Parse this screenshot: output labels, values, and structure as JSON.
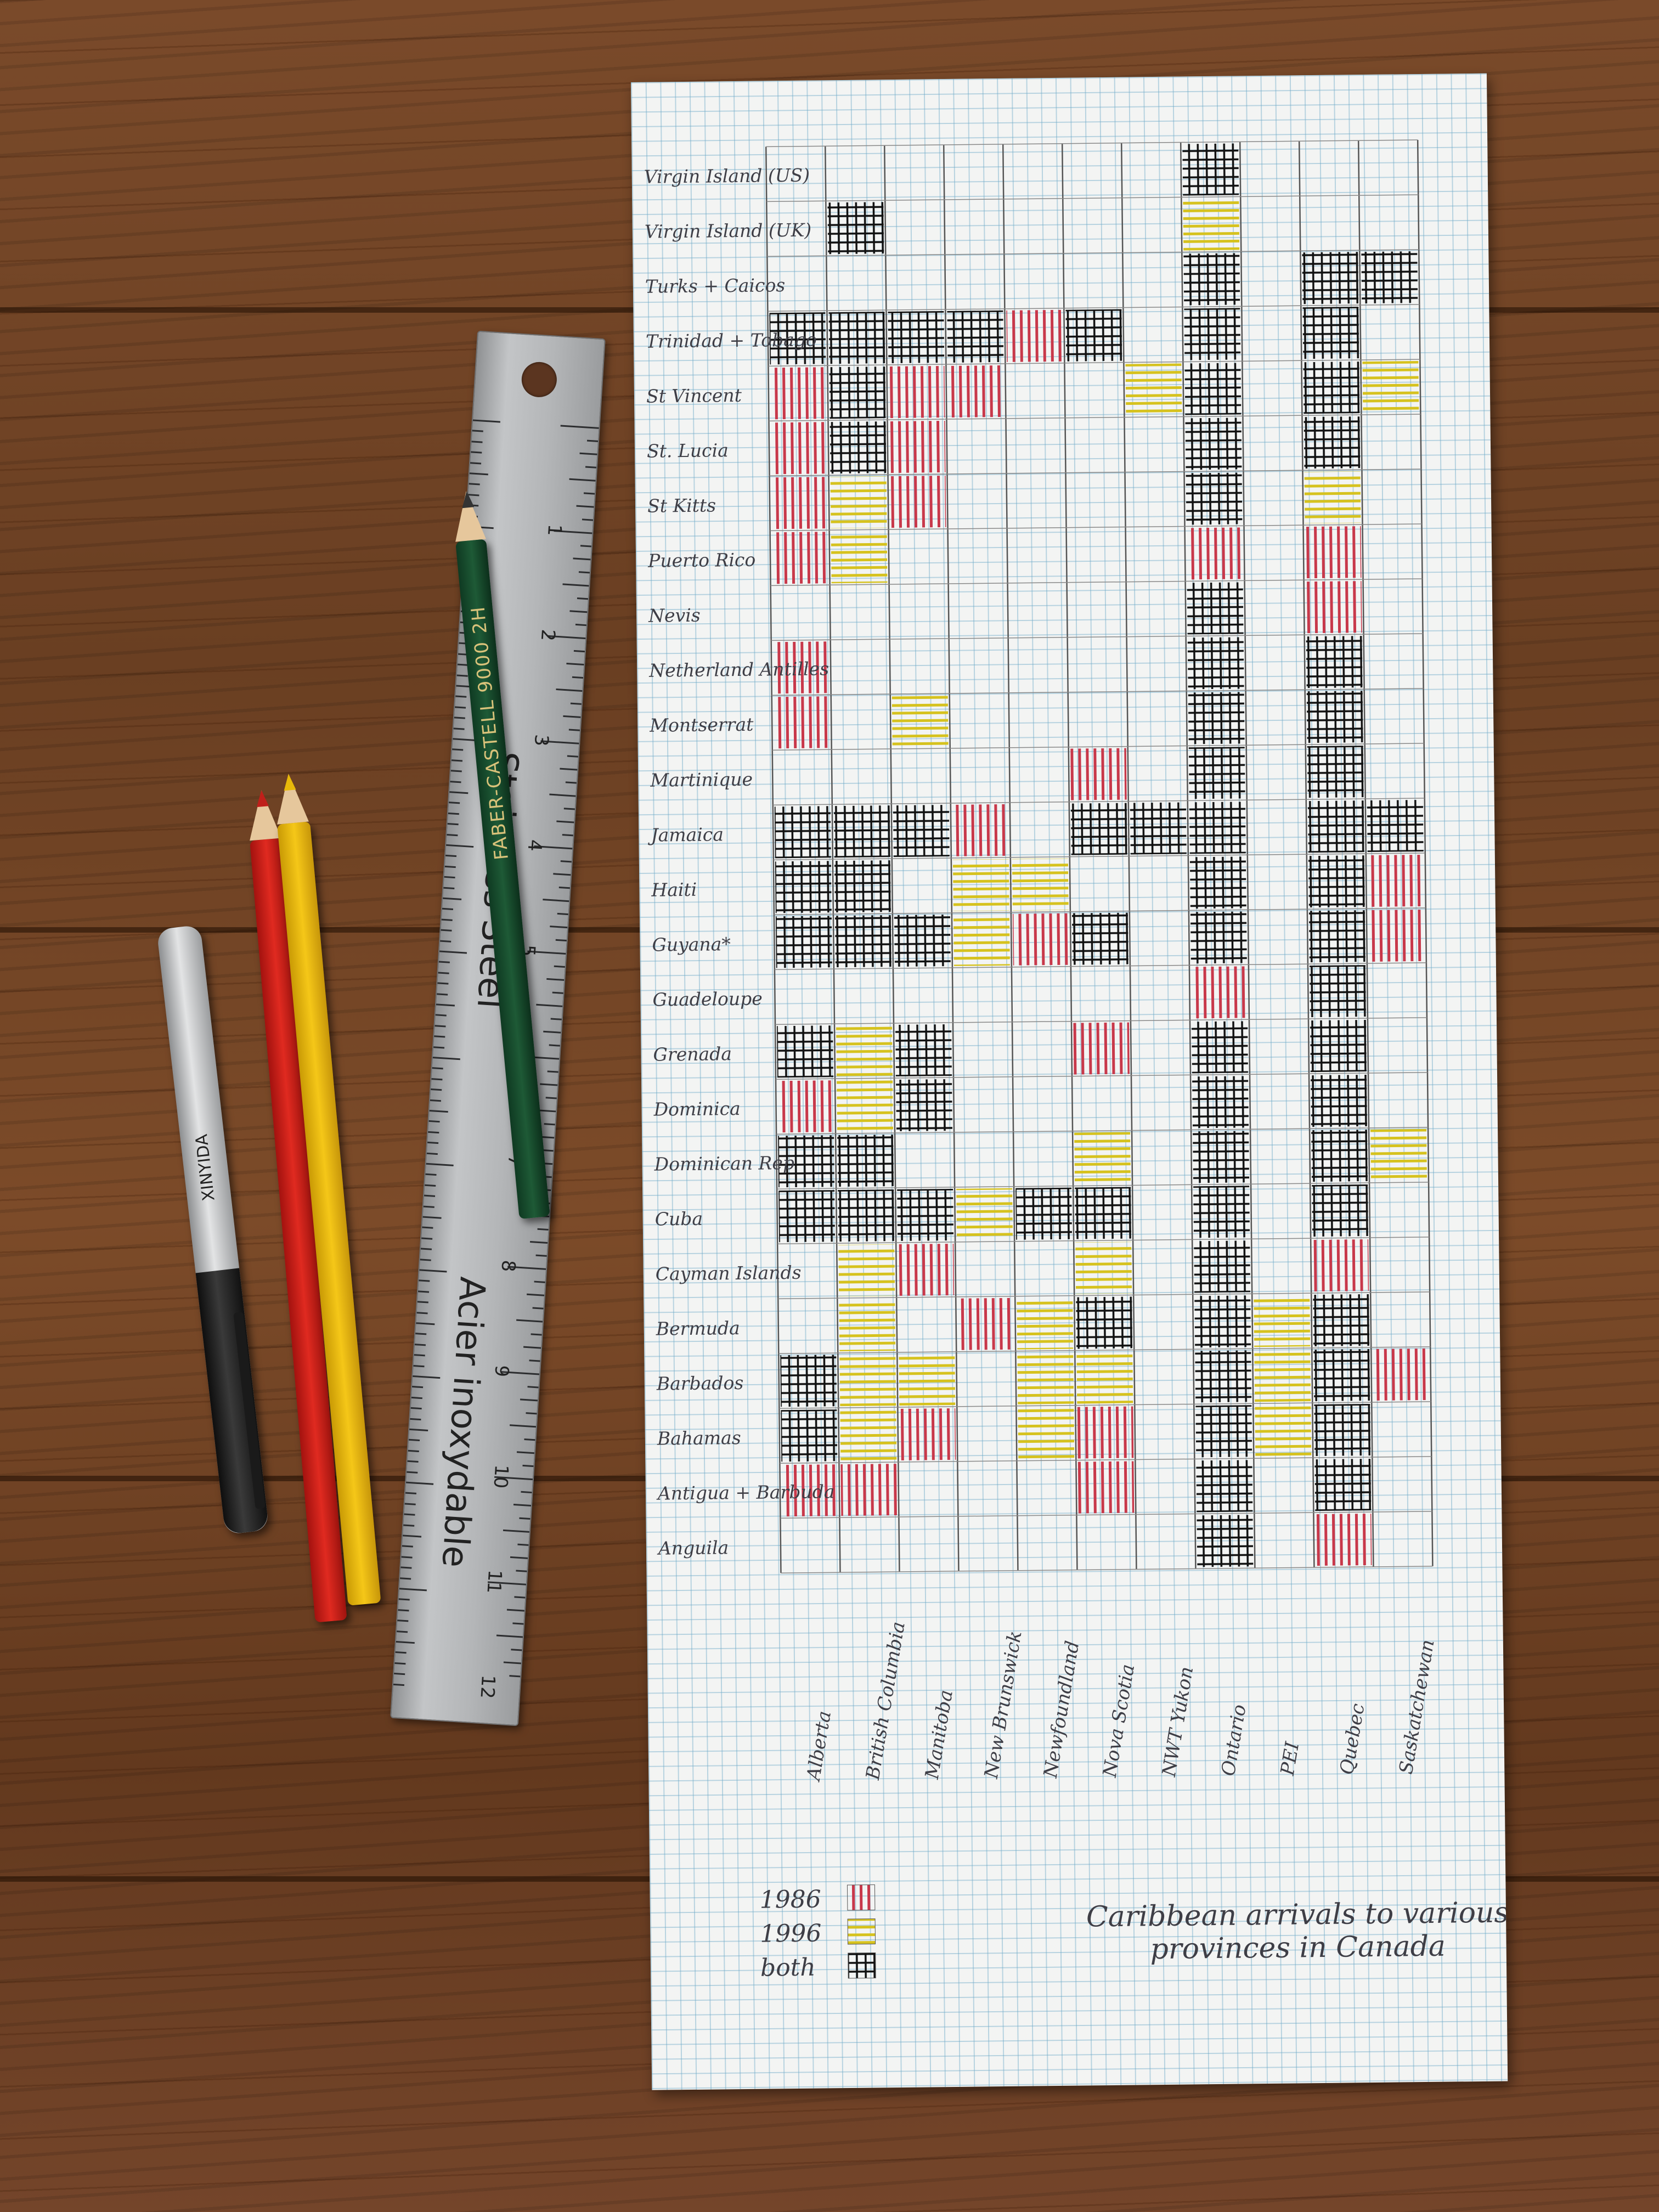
{
  "chart_data": {
    "type": "heatmap",
    "title": "Caribbean arrivals to various provinces in Canada",
    "rows": [
      "Virgin Island (US)",
      "Virgin Island (UK)",
      "Turks + Caicos",
      "Trinidad + Tobago",
      "St Vincent",
      "St. Lucia",
      "St Kitts",
      "Puerto Rico",
      "Nevis",
      "Netherland Antilles",
      "Montserrat",
      "Martinique",
      "Jamaica",
      "Haiti",
      "Guyana*",
      "Guadeloupe",
      "Grenada",
      "Dominica",
      "Dominican Rep",
      "Cuba",
      "Cayman Islands",
      "Bermuda",
      "Barbados",
      "Bahamas",
      "Antigua + Barbuda",
      "Anguila"
    ],
    "columns": [
      "Alberta",
      "British Columbia",
      "Manitoba",
      "New Brunswick",
      "Newfoundland",
      "Nova Scotia",
      "NWT Yukon",
      "Ontario",
      "PEI",
      "Quebec",
      "Saskatchewan"
    ],
    "legend": [
      {
        "code": "1986",
        "label": "1986",
        "color": "#c8384a"
      },
      {
        "code": "1996",
        "label": "1996",
        "color": "#d6c21e"
      },
      {
        "code": "both",
        "label": "both",
        "color": "#111111"
      }
    ],
    "cells": [
      [
        "",
        "",
        "",
        "",
        "",
        "",
        "",
        "both",
        "",
        "",
        ""
      ],
      [
        "",
        "both",
        "",
        "",
        "",
        "",
        "",
        "1996",
        "",
        "",
        ""
      ],
      [
        "",
        "",
        "",
        "",
        "",
        "",
        "",
        "both",
        "",
        "both",
        "both"
      ],
      [
        "both",
        "both",
        "both",
        "both",
        "1986",
        "both",
        "",
        "both",
        "",
        "both",
        ""
      ],
      [
        "1986",
        "both",
        "1986",
        "1986",
        "",
        "",
        "1996",
        "both",
        "",
        "both",
        "1996"
      ],
      [
        "1986",
        "both",
        "1986",
        "",
        "",
        "",
        "",
        "both",
        "",
        "both",
        ""
      ],
      [
        "1986",
        "1996",
        "1986",
        "",
        "",
        "",
        "",
        "both",
        "",
        "1996",
        ""
      ],
      [
        "1986",
        "1996",
        "",
        "",
        "",
        "",
        "",
        "1986",
        "",
        "1986",
        ""
      ],
      [
        "",
        "",
        "",
        "",
        "",
        "",
        "",
        "both",
        "",
        "1986",
        ""
      ],
      [
        "1986",
        "",
        "",
        "",
        "",
        "",
        "",
        "both",
        "",
        "both",
        ""
      ],
      [
        "1986",
        "",
        "1996",
        "",
        "",
        "",
        "",
        "both",
        "",
        "both",
        ""
      ],
      [
        "",
        "",
        "",
        "",
        "",
        "1986",
        "",
        "both",
        "",
        "both",
        ""
      ],
      [
        "both",
        "both",
        "both",
        "1986",
        "",
        "both",
        "both",
        "both",
        "",
        "both",
        "both"
      ],
      [
        "both",
        "both",
        "",
        "1996",
        "1996",
        "",
        "",
        "both",
        "",
        "both",
        "1986"
      ],
      [
        "both",
        "both",
        "both",
        "1996",
        "1986",
        "both",
        "",
        "both",
        "",
        "both",
        "1986"
      ],
      [
        "",
        "",
        "",
        "",
        "",
        "",
        "",
        "1986",
        "",
        "both",
        ""
      ],
      [
        "both",
        "1996",
        "both",
        "",
        "",
        "1986",
        "",
        "both",
        "",
        "both",
        ""
      ],
      [
        "1986",
        "1996",
        "both",
        "",
        "",
        "",
        "",
        "both",
        "",
        "both",
        ""
      ],
      [
        "both",
        "both",
        "",
        "",
        "",
        "1996",
        "",
        "both",
        "",
        "both",
        "1996"
      ],
      [
        "both",
        "both",
        "both",
        "1996",
        "both",
        "both",
        "",
        "both",
        "",
        "both",
        ""
      ],
      [
        "",
        "1996",
        "1986",
        "",
        "",
        "1996",
        "",
        "both",
        "",
        "1986",
        ""
      ],
      [
        "",
        "1996",
        "",
        "1986",
        "1996",
        "both",
        "",
        "both",
        "1996",
        "both",
        ""
      ],
      [
        "both",
        "1996",
        "1996",
        "",
        "1996",
        "1996",
        "",
        "both",
        "1996",
        "both",
        "1986"
      ],
      [
        "both",
        "1996",
        "1986",
        "",
        "1996",
        "1986",
        "",
        "both",
        "1996",
        "both",
        ""
      ],
      [
        "1986",
        "1986",
        "",
        "",
        "",
        "1986",
        "",
        "both",
        "",
        "both",
        ""
      ],
      [
        "",
        "",
        "",
        "",
        "",
        "",
        "",
        "both",
        "",
        "1986",
        ""
      ]
    ]
  },
  "props": {
    "ruler_text_1": "Stainless Steel",
    "ruler_text_2": "Acier inoxydable",
    "ruler_inch_numbers": [
      "1",
      "2",
      "3",
      "4",
      "5",
      "6",
      "7",
      "8",
      "9",
      "10",
      "11",
      "12"
    ],
    "pencil_brand": "FABER-CASTELL 9000 2H",
    "pen_brand": "XINYIDA"
  },
  "colors": {
    "wood": "#6f4426",
    "paper": "#f3f4f3",
    "grid_line": "#6eaac8",
    "ink": "#111111"
  }
}
